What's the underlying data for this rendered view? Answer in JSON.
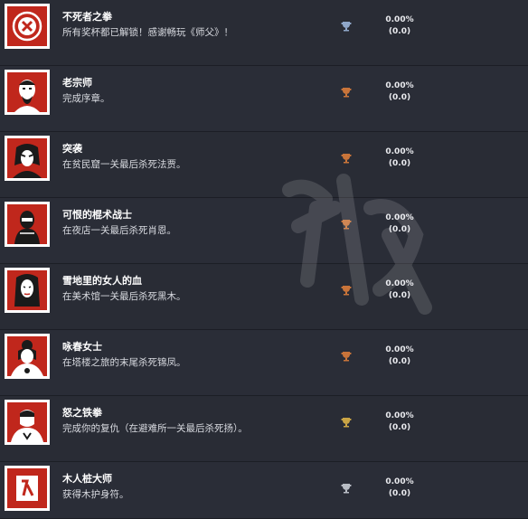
{
  "achievements": [
    {
      "title": "不死者之拳",
      "description": "所有奖杯都已解锁！感谢畅玩《师父》！",
      "trophy": "platinum",
      "trophy_color": "#8fa7c9",
      "percent": "0.00%",
      "count": "(0.0)",
      "icon": "platinum-seal-icon"
    },
    {
      "title": "老宗师",
      "description": "完成序章。",
      "trophy": "bronze",
      "trophy_color": "#c8743a",
      "percent": "0.00%",
      "count": "(0.0)",
      "icon": "old-master-portrait-icon"
    },
    {
      "title": "突袭",
      "description": "在贫民窟一关最后杀死法贾。",
      "trophy": "bronze",
      "trophy_color": "#c8743a",
      "percent": "0.00%",
      "count": "(0.0)",
      "icon": "fajar-portrait-icon"
    },
    {
      "title": "可恨的棍术战士",
      "description": "在夜店一关最后杀死肖恩。",
      "trophy": "bronze",
      "trophy_color": "#c8743a",
      "percent": "0.00%",
      "count": "(0.0)",
      "icon": "sean-portrait-icon"
    },
    {
      "title": "雪地里的女人的血",
      "description": "在美术馆一关最后杀死黑木。",
      "trophy": "bronze",
      "trophy_color": "#c8743a",
      "percent": "0.00%",
      "count": "(0.0)",
      "icon": "kuroki-portrait-icon"
    },
    {
      "title": "咏春女士",
      "description": "在塔楼之旅的末尾杀死锦凤。",
      "trophy": "bronze",
      "trophy_color": "#c8743a",
      "percent": "0.00%",
      "count": "(0.0)",
      "icon": "jinfeng-portrait-icon"
    },
    {
      "title": "怒之铁拳",
      "description": "完成你的复仇（在避难所一关最后杀死扬）。",
      "trophy": "gold",
      "trophy_color": "#c9a445",
      "percent": "0.00%",
      "count": "(0.0)",
      "icon": "yang-portrait-icon"
    },
    {
      "title": "木人桩大师",
      "description": "获得木护身符。",
      "trophy": "silver",
      "trophy_color": "#b8bcc4",
      "percent": "0.00%",
      "count": "(0.0)",
      "icon": "wooden-amulet-icon"
    }
  ]
}
